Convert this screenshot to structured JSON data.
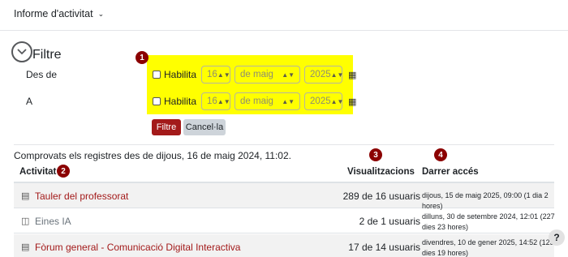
{
  "report_menu": {
    "label": "Informe d'activitat"
  },
  "filter": {
    "title": "Filtre",
    "from_label": "Des de",
    "to_label": "A",
    "from": {
      "enable_label": "Habilita",
      "day": "16",
      "month": "de maig",
      "year": "2025"
    },
    "to": {
      "enable_label": "Habilita",
      "day": "16",
      "month": "de maig",
      "year": "2025"
    },
    "filter_button": "Filtre",
    "cancel_button": "Cancel·la"
  },
  "badges": [
    "1",
    "2",
    "3",
    "4"
  ],
  "info_text": "Comprovats els registres des de dijous, 16 de maig 2024, 11:02.",
  "table": {
    "headers": {
      "activity": "Activitat",
      "views": "Visualitzacions",
      "last_access": "Darrer accés"
    },
    "rows": [
      {
        "icon": "forum-icon",
        "name": "Tauler del professorat",
        "views": "289 de 16 usuaris",
        "last_access": "dijous, 15 de maig 2025, 09:00 (1 dia 2 hores)"
      },
      {
        "icon": "file-icon",
        "name": "Eines IA",
        "views": "2 de 1 usuaris",
        "last_access": "dilluns, 30 de setembre 2024, 12:01 (227 dies 23 hores)"
      },
      {
        "icon": "forum-icon",
        "name": "Fòrum general - Comunicació Digital Interactiva",
        "views": "17 de 14 usuaris",
        "last_access": "divendres, 10 de gener 2025, 14:52 (125 dies 19 hores)"
      }
    ]
  },
  "help_button": "?",
  "colors": {
    "highlight": "#ffff00",
    "badge": "#8b0000",
    "primary": "#a31a1a"
  }
}
